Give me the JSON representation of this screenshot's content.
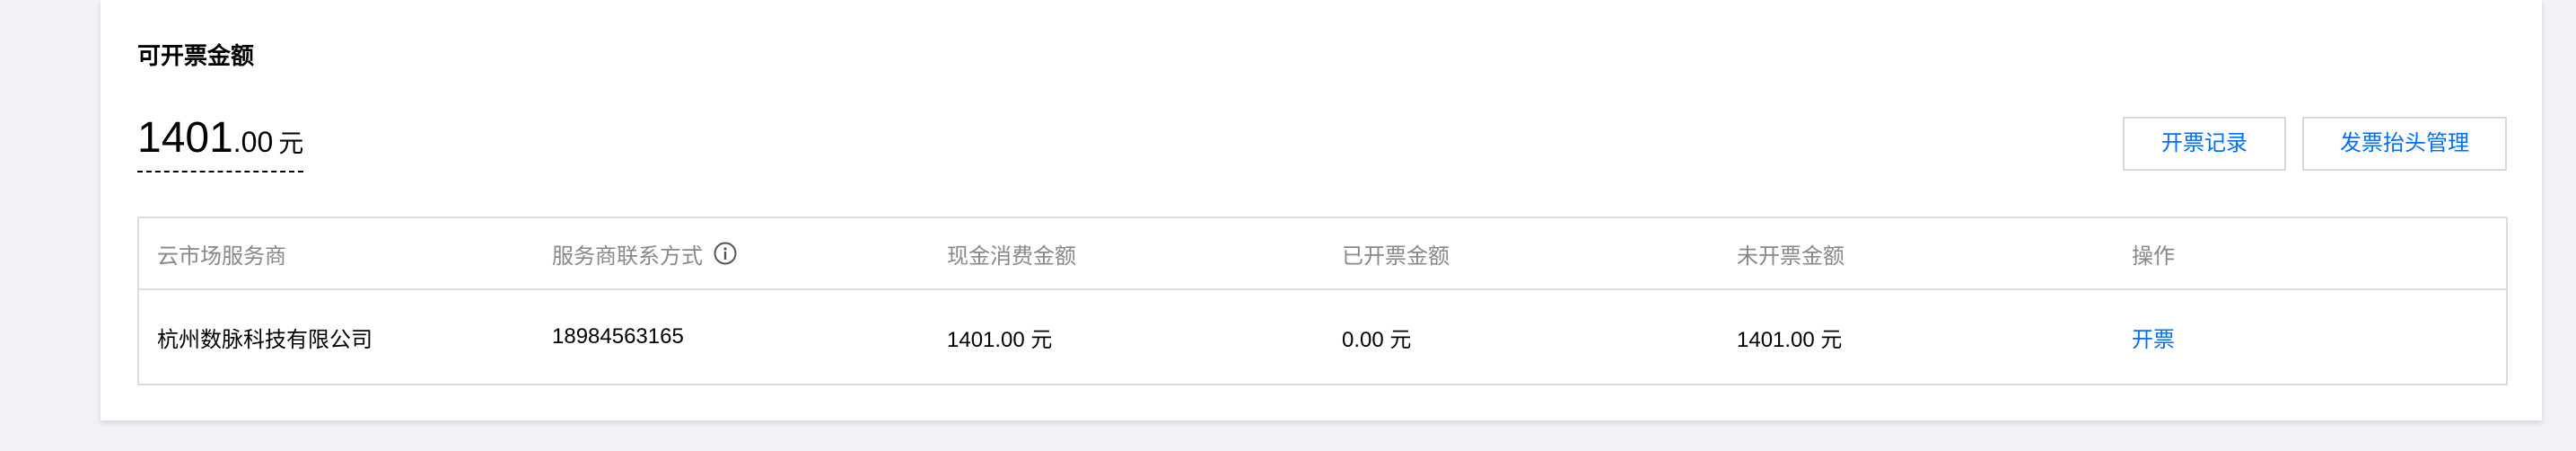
{
  "invoice": {
    "title": "可开票金额",
    "amount_int": "1401",
    "amount_dec": ".00",
    "amount_unit": "元"
  },
  "actions": {
    "records_label": "开票记录",
    "header_mgmt_label": "发票抬头管理"
  },
  "table": {
    "headers": [
      "云市场服务商",
      "服务商联系方式",
      "现金消费金额",
      "已开票金额",
      "未开票金额",
      "操作"
    ],
    "rows": [
      {
        "provider": "杭州数脉科技有限公司",
        "contact": "18984563165",
        "cash_spent": "1401.00 元",
        "invoiced": "0.00 元",
        "uninvoiced": "1401.00 元",
        "action": "开票"
      }
    ]
  },
  "icons": {
    "contact_header_icon": "info-icon"
  },
  "colors": {
    "accent": "#006eff",
    "border": "#dcdcdc",
    "header_text": "#888888",
    "background": "#f0f2f5"
  }
}
